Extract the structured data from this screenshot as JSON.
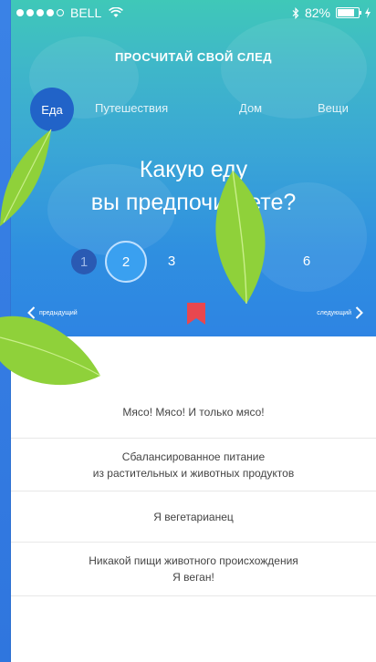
{
  "status": {
    "carrier": "BELL",
    "battery": "82%",
    "battery_level": 0.82
  },
  "header": {
    "title": "ПРОСЧИТАЙ СВОЙ СЛЕД"
  },
  "tabs": [
    {
      "label": "Еда",
      "active": true
    },
    {
      "label": "Путешествия",
      "active": false
    },
    {
      "label": "Дом",
      "active": false
    },
    {
      "label": "Вещи",
      "active": false
    }
  ],
  "question": {
    "line1": "Какую еду",
    "line2": "вы предпочитаете?"
  },
  "steps": {
    "s1": "1",
    "s2": "2",
    "s3": "3",
    "s6": "6",
    "current": 2
  },
  "nav": {
    "prev_label": "предыдущий",
    "next_label": "следующий"
  },
  "answers": [
    "Мясо! Мясо! И только мясо!",
    "Сбалансированное питание\nиз растительных и животных продуктов",
    "Я вегетарианец",
    "Никакой пищи животного происхождения\nЯ веган!"
  ],
  "colors": {
    "accent": "#2163c8",
    "bookmark": "#e8474f",
    "leaf": "#8fd13a"
  }
}
